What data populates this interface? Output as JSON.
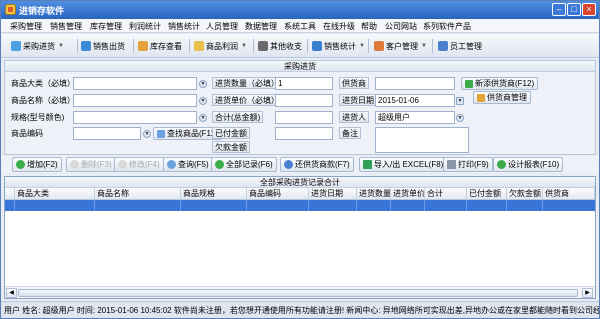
{
  "window": {
    "title": "进销存软件",
    "min": "–",
    "max": "□",
    "close": "×"
  },
  "menu": [
    "采购管理",
    "销售管理",
    "库存管理",
    "利润统计",
    "销售统计",
    "人员管理",
    "数据管理",
    "系统工具",
    "在线升级",
    "帮助",
    "公司网站",
    "系列软件产品"
  ],
  "toolbar": {
    "purchase_in": "采购进货",
    "sales_out": "销售出货",
    "stock_view": "库存查看",
    "goods_profit": "商品利润",
    "other_income": "其他收支",
    "sales_stats": "销售统计",
    "customer_mgmt": "客户管理",
    "staff_mgmt": "员工管理"
  },
  "form": {
    "panel_title": "采购进货",
    "category_label": "商品大类（必填）",
    "name_label": "商品名称（必填）",
    "spec_label": "规格(型号颜色)",
    "code_label": "商品编码",
    "find_goods": "查找商品(F11)",
    "qty_label": "进货数量（必填）",
    "qty_value": "1",
    "price_label": "进货单价（必填）",
    "total_label": "合计(总金额)",
    "paid_label": "已付金额",
    "owed_label": "欠款金额",
    "supplier_label": "供货商",
    "date_label": "进货日期",
    "date_value": "2015-01-06",
    "buyer_label": "进货人",
    "buyer_value": "超级用户",
    "note_label": "备注",
    "add_supplier": "新添供货商(F12)",
    "supplier_mgmt": "供货商管理"
  },
  "actions": {
    "add": "增加(F2)",
    "delete": "删除(F3)",
    "modify": "修改(F4)",
    "query": "查询(F5)",
    "all_records": "全部记录(F6)",
    "pay_supplier": "还供货商款(F7)",
    "import_excel": "导入/出 EXCEL(F8)",
    "print": "打印(F9)",
    "design_report": "设计报表(F10)"
  },
  "grid": {
    "title": "全部采购进货记录合计",
    "columns": [
      "商品大类",
      "商品名称",
      "商品规格",
      "商品编码",
      "进货日期",
      "进货数量",
      "进货单价",
      "合计",
      "已付金额",
      "欠款金额",
      "供货商"
    ]
  },
  "status": {
    "text": "用户  姓名: 超级用户  时间: 2015-01-06 10:45:02 软件尚未注册，若您想开通使用所有功能请注册! 新闻中心: 异地网络所可实现出差,异地办公或在家里都能随时看到公司经"
  },
  "colors": {
    "titlebar": "#2a64c2",
    "selection": "#3875d7",
    "close": "#d9462e"
  }
}
